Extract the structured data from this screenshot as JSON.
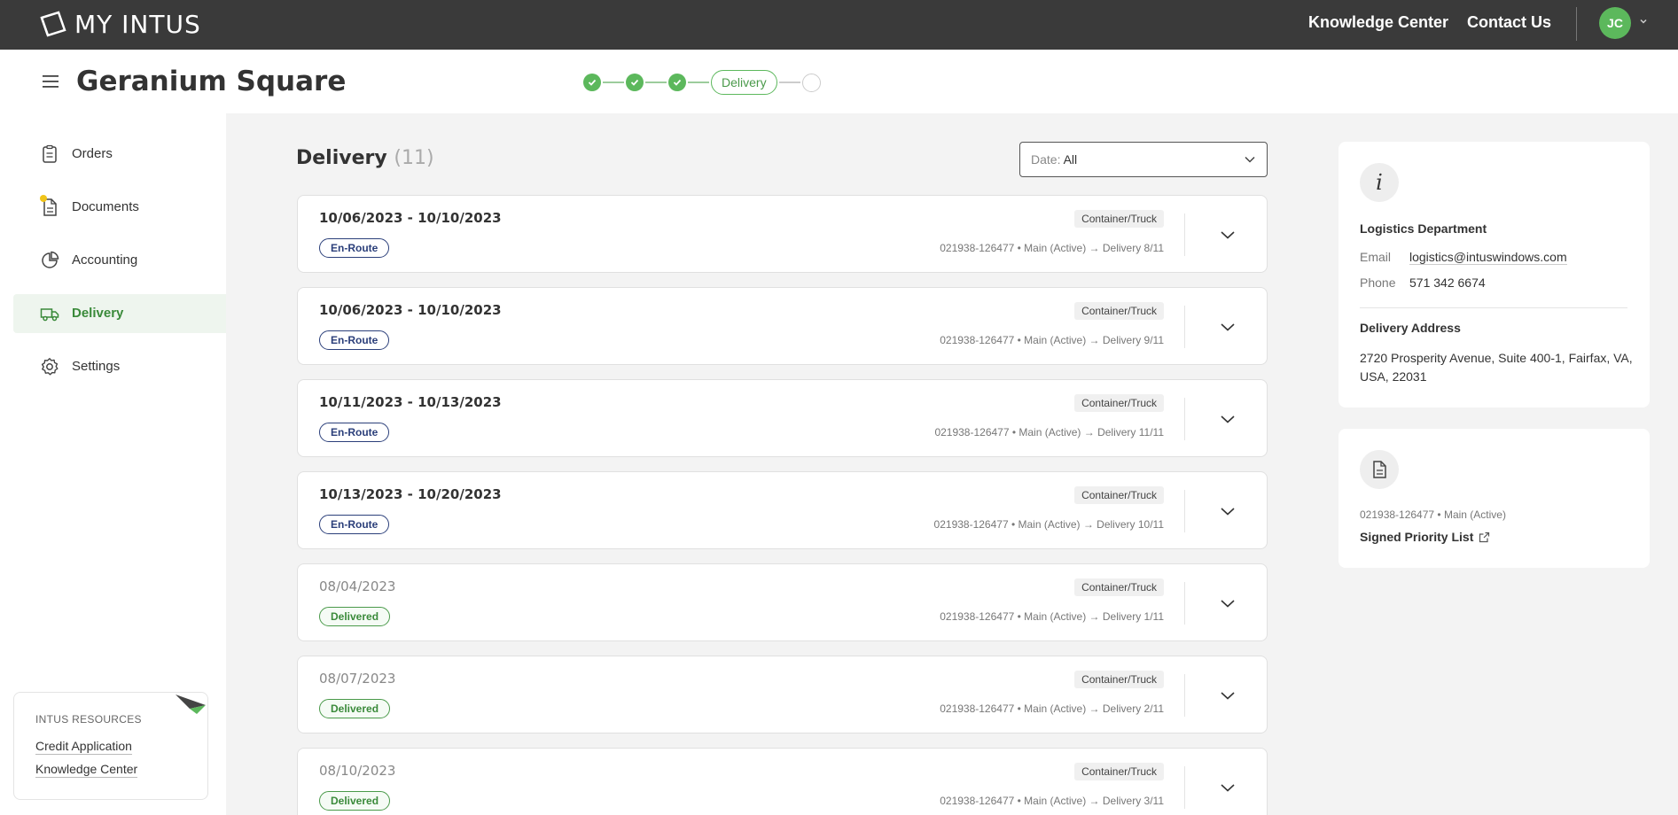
{
  "topbar": {
    "logo_text": "MY INTUS",
    "links": [
      "Knowledge Center",
      "Contact Us"
    ],
    "user_initials": "JC"
  },
  "header": {
    "project_title": "Geranium Square",
    "stepper": {
      "completed_steps": 3,
      "current_label": "Delivery",
      "remaining_steps": 1
    }
  },
  "sidebar": {
    "items": [
      {
        "label": "Orders",
        "icon": "clipboard-icon"
      },
      {
        "label": "Documents",
        "icon": "document-icon"
      },
      {
        "label": "Accounting",
        "icon": "pie-chart-icon"
      },
      {
        "label": "Delivery",
        "icon": "truck-icon",
        "active": true
      },
      {
        "label": "Settings",
        "icon": "gear-icon"
      }
    ],
    "resources": {
      "title": "INTUS RESOURCES",
      "links": [
        "Credit Application",
        "Knowledge Center"
      ]
    }
  },
  "main": {
    "title": "Delivery",
    "count": "(11)",
    "filter": {
      "label": "Date:",
      "value": "All"
    },
    "deliveries": [
      {
        "date": "10/06/2023 - 10/10/2023",
        "status": "En-Route",
        "type": "Container/Truck",
        "meta": "021938-126477 • Main (Active) → Delivery 8/11"
      },
      {
        "date": "10/06/2023 - 10/10/2023",
        "status": "En-Route",
        "type": "Container/Truck",
        "meta": "021938-126477 • Main (Active) → Delivery 9/11"
      },
      {
        "date": "10/11/2023 - 10/13/2023",
        "status": "En-Route",
        "type": "Container/Truck",
        "meta": "021938-126477 • Main (Active) → Delivery 11/11"
      },
      {
        "date": "10/13/2023 - 10/20/2023",
        "status": "En-Route",
        "type": "Container/Truck",
        "meta": "021938-126477 • Main (Active) → Delivery 10/11"
      },
      {
        "date": "08/04/2023",
        "status": "Delivered",
        "type": "Container/Truck",
        "meta": "021938-126477 • Main (Active) → Delivery 1/11"
      },
      {
        "date": "08/07/2023",
        "status": "Delivered",
        "type": "Container/Truck",
        "meta": "021938-126477 • Main (Active) → Delivery 2/11"
      },
      {
        "date": "08/10/2023",
        "status": "Delivered",
        "type": "Container/Truck",
        "meta": "021938-126477 • Main (Active) → Delivery 3/11"
      }
    ]
  },
  "info": {
    "icon_glyph": "i",
    "department": "Logistics Department",
    "email_label": "Email",
    "email": "logistics@intuswindows.com",
    "phone_label": "Phone",
    "phone": "571 342 6674",
    "address_heading": "Delivery Address",
    "address": "2720 Prosperity Avenue, Suite 400-1, Fairfax, VA, USA, 22031"
  },
  "document": {
    "meta": "021938-126477 • Main (Active)",
    "link_label": "Signed Priority List"
  },
  "colors": {
    "topbar": "#3a3a3a",
    "accent_green": "#5cb85c",
    "enroute_blue": "#2b3f7a",
    "main_bg": "#f3f3f3"
  }
}
